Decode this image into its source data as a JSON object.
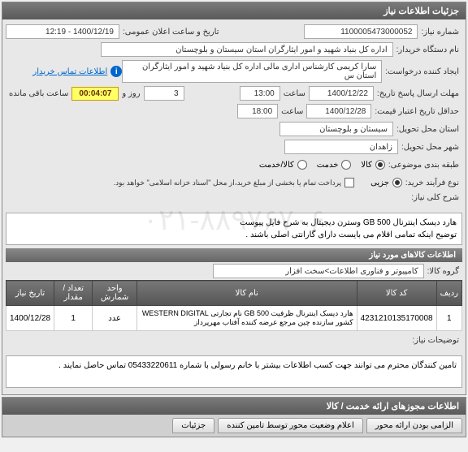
{
  "panel1": {
    "title": "جزئیات اطلاعات نیاز",
    "need_no_label": "شماره نیاز:",
    "need_no": "1100005473000052",
    "announce_label": "تاریخ و ساعت اعلان عمومی:",
    "announce_value": "1400/12/19 - 12:19",
    "buyer_label": "نام دستگاه خریدار:",
    "buyer_value": "اداره کل بنیاد شهید و امور ایثارگران استان سیستان و بلوچستان",
    "creator_label": "ایجاد کننده درخواست:",
    "creator_value": "سارا کریمی کارشناس اداری مالی اداره کل بنیاد شهید و امور ایثارگران استان س",
    "contact_link": "اطلاعات تماس خریدار",
    "deadline_label": "مهلت ارسال پاسخ تاریخ:",
    "deadline_date": "1400/12/22",
    "time_label": "ساعت",
    "deadline_time": "13:00",
    "days": "3",
    "days_label": "روز و",
    "countdown": "00:04:07",
    "remaining_label": "ساعت باقی مانده",
    "min_valid_label": "حداقل تاریخ اعتبار قیمت:",
    "min_valid_date": "1400/12/28",
    "min_valid_time": "18:00",
    "province_label": "استان محل تحویل:",
    "province": "سیستان و بلوچستان",
    "city_label": "شهر محل تحویل:",
    "city": "زاهدان",
    "budget_label": "طبقه بندی موضوعی:",
    "opt_goods": "کالا",
    "opt_service": "خدمت",
    "opt_both": "کالا/خدمت",
    "process_label": "نوع فرآیند خرید:",
    "checkbox_text": "پرداخت تمام یا بخشی از مبلغ خرید،از محل \"اسناد خزانه اسلامی\" خواهد بود.",
    "part_label": "جزیی",
    "desc_label": "شرح کلی نیاز:",
    "desc_text": "هارد دیسک اینترنال GB 500 وسترن دیجیتال به شرح فایل پیوست\nتوضیح اینکه تمامی اقلام می بایست دارای گارانتی اصلی باشند ."
  },
  "panel2": {
    "title": "اطلاعات کالاهای مورد نیاز",
    "group_label": "گروه کالا:",
    "group_value": "کامپیوتر و فناوری اطلاعات>سخت افزار",
    "headers": {
      "row": "ردیف",
      "code": "کد کالا",
      "name": "نام کالا",
      "unit": "واحد شمارش",
      "qty": "تعداد / مقدار",
      "date": "تاریخ نیاز"
    },
    "row1": {
      "n": "1",
      "code": "4231210135170008",
      "name": "هارد دیسک اینترنال ظرفیت GB 500 نام تجارتی WESTERN DIGITAL کشور سازنده چین مرجع عرضه کننده آفتاب مهرپرداز",
      "unit": "عدد",
      "qty": "1",
      "date": "1400/12/28"
    },
    "notes_label": "توضیحات نیاز:",
    "notes_text": "تامین کنندگان محترم می توانند جهت کسب اطلاعات بیشتر با خانم رسولی با شماره 05433220611 تماس حاصل نمایند ."
  },
  "panel3": {
    "title": "اطلاعات مجوزهای ارائه خدمت / کالا"
  },
  "tabs": {
    "t1": "الزامی بودن ارائه محور",
    "t2": "اعلام وضعیت محور توسط تامین کننده",
    "t3": "جزئیات"
  },
  "watermark": "۰۲۱-۸۸۹۷۶۷۰۶"
}
